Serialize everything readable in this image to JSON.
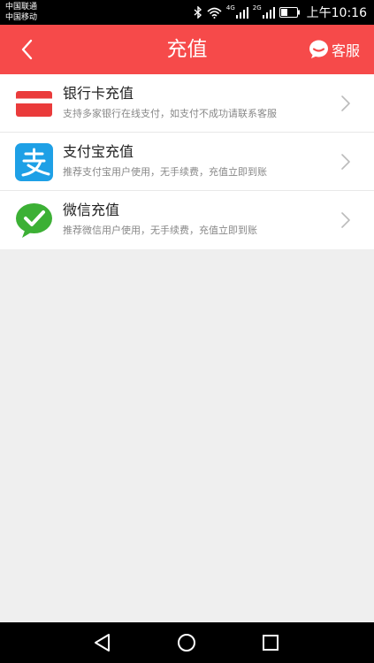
{
  "status": {
    "carrier_1": "中国联通",
    "carrier_2": "中国移动",
    "net_1": "4G",
    "net_2": "2G",
    "time": "上午10:16"
  },
  "header": {
    "title": "充值",
    "back_icon": "chevron-left-icon",
    "service_icon": "chat-bubble-icon",
    "service_label": "客服",
    "background": "#f64a4a"
  },
  "methods": [
    {
      "title": "银行卡充值",
      "desc": "支持多家银行在线支付，如支付不成功请联系客服",
      "icon": "bank-card-icon",
      "color": "#ea3b3b"
    },
    {
      "title": "支付宝充值",
      "desc": "推荐支付宝用户使用，无手续费，充值立即到账",
      "icon": "alipay-icon",
      "color": "#1ea0e6"
    },
    {
      "title": "微信充值",
      "desc": "推荐微信用户使用，无手续费，充值立即到账",
      "icon": "wechat-icon",
      "color": "#3cb035"
    }
  ],
  "navbar": {
    "icons": [
      "back-triangle-icon",
      "home-circle-icon",
      "recents-square-icon"
    ]
  }
}
